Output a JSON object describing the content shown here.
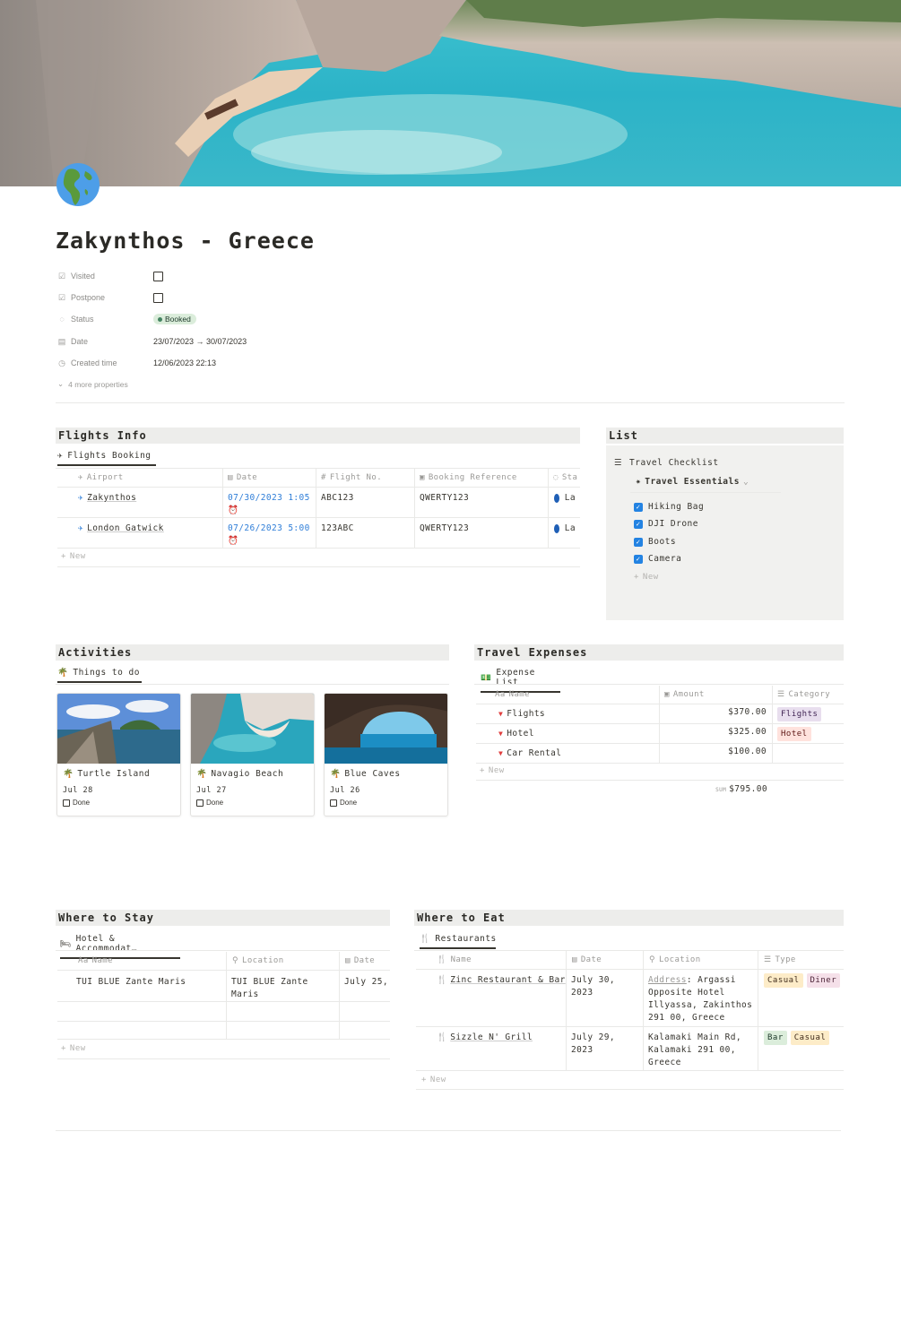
{
  "page": {
    "title": "Zakynthos - Greece",
    "icon": "globe-americas-icon"
  },
  "properties": [
    {
      "key": "Visited",
      "icon": "checkbox-icon",
      "type": "checkbox",
      "value": false
    },
    {
      "key": "Postpone",
      "icon": "checkbox-icon",
      "type": "checkbox",
      "value": false
    },
    {
      "key": "Status",
      "icon": "status-icon",
      "type": "status",
      "value": "Booked",
      "color": "#dbeddb"
    },
    {
      "key": "Date",
      "icon": "calendar-icon",
      "type": "text",
      "value": "23/07/2023 → 30/07/2023"
    },
    {
      "key": "Created time",
      "icon": "clock-icon",
      "type": "text",
      "value": "12/06/2023 22:13"
    }
  ],
  "more_properties": "4 more properties",
  "flights": {
    "heading": "Flights Info",
    "view": "Flights Booking",
    "columns": [
      "Airport",
      "Date",
      "Flight No.",
      "Booking Reference",
      "Sta"
    ],
    "rows": [
      {
        "airport": "Zakynthos",
        "date": "07/30/2023 1:05",
        "flight": "ABC123",
        "ref": "QWERTY123",
        "status": "La"
      },
      {
        "airport": "London Gatwick",
        "date": "07/26/2023 5:00",
        "flight": "123ABC",
        "ref": "QWERTY123",
        "status": "La"
      }
    ],
    "new": "New"
  },
  "list": {
    "heading": "List",
    "checklist_title": "Travel Checklist",
    "group": "Travel Essentials",
    "items": [
      "Hiking Bag",
      "DJI Drone",
      "Boots",
      "Camera"
    ],
    "new": "New"
  },
  "activities": {
    "heading": "Activities",
    "view": "Things to do",
    "cards": [
      {
        "name": "Turtle Island",
        "date": "Jul 28",
        "done_label": "Done"
      },
      {
        "name": "Navagio Beach",
        "date": "Jul 27",
        "done_label": "Done"
      },
      {
        "name": "Blue Caves",
        "date": "Jul 26",
        "done_label": "Done"
      }
    ]
  },
  "expenses": {
    "heading": "Travel Expenses",
    "view": "Expense List",
    "columns": [
      "Name",
      "Amount",
      "Category"
    ],
    "rows": [
      {
        "name": "Flights",
        "amount": "$370.00",
        "category": "Flights"
      },
      {
        "name": "Hotel",
        "amount": "$325.00",
        "category": "Hotel"
      },
      {
        "name": "Car Rental",
        "amount": "$100.00",
        "category": ""
      }
    ],
    "new": "New",
    "sum_label": "SUM",
    "sum_value": "$795.00"
  },
  "stay": {
    "heading": "Where to Stay",
    "view": "Hotel & Accommodat…",
    "columns": [
      "Name",
      "Location",
      "Date"
    ],
    "rows": [
      {
        "name": "TUI BLUE Zante Maris",
        "location_1": "TUI BLUE Zante",
        "location_2": "Maris",
        "date": "July 25,"
      }
    ],
    "new": "New"
  },
  "eat": {
    "heading": "Where to Eat",
    "view": "Restaurants",
    "columns": [
      "Name",
      "Date",
      "Location",
      "Type"
    ],
    "rows": [
      {
        "name": "Zinc Restaurant & Bar",
        "date_1": "July 30,",
        "date_2": "2023",
        "loc_label": "Address",
        "loc_1": ": Argassi",
        "loc_2": "Opposite Hotel",
        "loc_3": "Illyassa, Zakinthos",
        "loc_4": "291 00, Greece",
        "tags": [
          "Casual",
          "Diner"
        ]
      },
      {
        "name": "Sizzle N' Grill",
        "date_1": "July 29,",
        "date_2": "2023",
        "loc_1": "Kalamaki Main Rd,",
        "loc_2": "Kalamaki 291 00,",
        "loc_3": "Greece",
        "tags": [
          "Bar",
          "Casual"
        ]
      }
    ],
    "new": "New"
  }
}
